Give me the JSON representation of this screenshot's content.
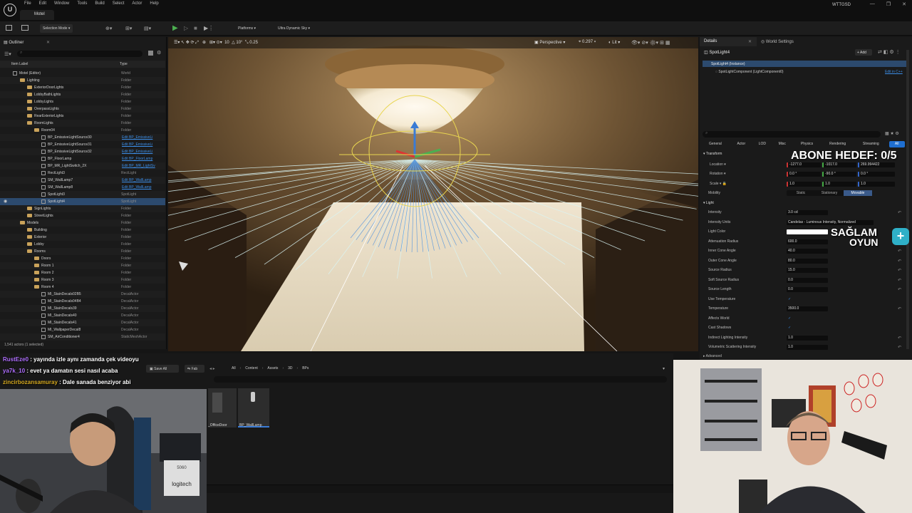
{
  "window": {
    "app_tab": "Motel",
    "user": "WTTGSD",
    "menu": [
      "File",
      "Edit",
      "Window",
      "Tools",
      "Build",
      "Select",
      "Actor",
      "Help"
    ],
    "controls": [
      "—",
      "❐",
      "✕"
    ]
  },
  "toolbar": {
    "selection_mode": "Selection Mode",
    "platforms": "Platforms",
    "sky": "Ultra Dynamic Sky"
  },
  "outliner": {
    "tab": "Outliner",
    "col_label": "Item Label",
    "col_type": "Type",
    "status": "1,541 actors (1 selected)",
    "rows": [
      {
        "label": "Motel (Editor)",
        "type": "World",
        "indent": 0,
        "kind": "world"
      },
      {
        "label": "Lighting",
        "type": "Folder",
        "indent": 1,
        "kind": "folder"
      },
      {
        "label": "ExteriorDoorLights",
        "type": "Folder",
        "indent": 2,
        "kind": "folder"
      },
      {
        "label": "LobbyBathLights",
        "type": "Folder",
        "indent": 2,
        "kind": "folder"
      },
      {
        "label": "LobbyLights",
        "type": "Folder",
        "indent": 2,
        "kind": "folder"
      },
      {
        "label": "OverpassLights",
        "type": "Folder",
        "indent": 2,
        "kind": "folder"
      },
      {
        "label": "RearExteriorLights",
        "type": "Folder",
        "indent": 2,
        "kind": "folder"
      },
      {
        "label": "RoomLights",
        "type": "Folder",
        "indent": 2,
        "kind": "folder"
      },
      {
        "label": "Room04",
        "type": "Folder",
        "indent": 3,
        "kind": "folder"
      },
      {
        "label": "BP_EmissiveLightSource30",
        "type": "Edit BP_EmissiveLi",
        "indent": 4,
        "kind": "bp"
      },
      {
        "label": "BP_EmissiveLightSource31",
        "type": "Edit BP_EmissiveLi",
        "indent": 4,
        "kind": "bp"
      },
      {
        "label": "BP_EmissiveLightSource32",
        "type": "Edit BP_EmissiveLi",
        "indent": 4,
        "kind": "bp"
      },
      {
        "label": "BP_FloorLamp",
        "type": "Edit BP_FloorLamp",
        "indent": 4,
        "kind": "bp"
      },
      {
        "label": "BP_MR_LightSwitch_2X",
        "type": "Edit BP_MR_LightSv",
        "indent": 4,
        "kind": "bp"
      },
      {
        "label": "RectLight3",
        "type": "RectLight",
        "indent": 4,
        "kind": "actor"
      },
      {
        "label": "SM_WallLamp7",
        "type": "Edit BP_WallLamp",
        "indent": 4,
        "kind": "bp"
      },
      {
        "label": "SM_WallLamp8",
        "type": "Edit BP_WallLamp",
        "indent": 4,
        "kind": "bp"
      },
      {
        "label": "SpotLight3",
        "type": "SpotLight",
        "indent": 4,
        "kind": "actor"
      },
      {
        "label": "SpotLight4",
        "type": "SpotLight",
        "indent": 4,
        "kind": "actor",
        "selected": true
      },
      {
        "label": "SignLights",
        "type": "Folder",
        "indent": 2,
        "kind": "folder"
      },
      {
        "label": "StreetLights",
        "type": "Folder",
        "indent": 2,
        "kind": "folder"
      },
      {
        "label": "Models",
        "type": "Folder",
        "indent": 1,
        "kind": "folder"
      },
      {
        "label": "Building",
        "type": "Folder",
        "indent": 2,
        "kind": "folder"
      },
      {
        "label": "Exterior",
        "type": "Folder",
        "indent": 2,
        "kind": "folder"
      },
      {
        "label": "Lobby",
        "type": "Folder",
        "indent": 2,
        "kind": "folder"
      },
      {
        "label": "Rooms",
        "type": "Folder",
        "indent": 2,
        "kind": "folder"
      },
      {
        "label": "Doors",
        "type": "Folder",
        "indent": 3,
        "kind": "folder"
      },
      {
        "label": "Room 1",
        "type": "Folder",
        "indent": 3,
        "kind": "folder"
      },
      {
        "label": "Room 2",
        "type": "Folder",
        "indent": 3,
        "kind": "folder"
      },
      {
        "label": "Room 3",
        "type": "Folder",
        "indent": 3,
        "kind": "folder"
      },
      {
        "label": "Room 4",
        "type": "Folder",
        "indent": 3,
        "kind": "folder"
      },
      {
        "label": "MI_StainDecals02B5",
        "type": "DecalActor",
        "indent": 4,
        "kind": "actor"
      },
      {
        "label": "MI_StainDecals04B4",
        "type": "DecalActor",
        "indent": 4,
        "kind": "actor"
      },
      {
        "label": "MI_StainDecals39",
        "type": "DecalActor",
        "indent": 4,
        "kind": "actor"
      },
      {
        "label": "MI_StainDecals40",
        "type": "DecalActor",
        "indent": 4,
        "kind": "actor"
      },
      {
        "label": "MI_StainDecals41",
        "type": "DecalActor",
        "indent": 4,
        "kind": "actor"
      },
      {
        "label": "MI_WallpaperDecal8",
        "type": "DecalActor",
        "indent": 4,
        "kind": "actor"
      },
      {
        "label": "SM_AirConditioner4",
        "type": "StaticMeshActor",
        "indent": 4,
        "kind": "actor"
      }
    ]
  },
  "viewport": {
    "perspective": "Perspective",
    "lit": "Lit",
    "grid": "10",
    "angle": "10°",
    "scale": "0.25",
    "fov": "0.297"
  },
  "details": {
    "tab": "Details",
    "tab2": "World Settings",
    "actor_name": "SpotLight4",
    "add": "+ Add",
    "instance": "SpotLight4 (Instance)",
    "component": "SpotLightComponent (LightComponent0)",
    "edit_cpp": "Edit in C++",
    "filters": [
      "General",
      "Actor",
      "LOD",
      "Misc",
      "Physics",
      "Rendering",
      "Streaming",
      "All"
    ],
    "transform": "Transform",
    "location_lbl": "Location",
    "rotation_lbl": "Rotation",
    "scale_lbl": "Scale",
    "mobility_lbl": "Mobility",
    "location": [
      "-1277.0",
      "-1017.0",
      "269.994422"
    ],
    "rotation": [
      "0.0 °",
      "-90.0 °",
      "0.0 °"
    ],
    "scale": [
      "1.0",
      "1.0",
      "1.0"
    ],
    "mobility": [
      "Static",
      "Stationary",
      "Movable"
    ],
    "light": "Light",
    "props": [
      {
        "label": "Intensity",
        "value": "3.0 cd"
      },
      {
        "label": "Intensity Units",
        "value": "Candelas - Luminous Intensity, Normalized"
      },
      {
        "label": "Light Color",
        "value": ""
      },
      {
        "label": "Attenuation Radius",
        "value": "600.0"
      },
      {
        "label": "Inner Cone Angle",
        "value": "40.0"
      },
      {
        "label": "Outer Cone Angle",
        "value": "80.0"
      },
      {
        "label": "Source Radius",
        "value": "15.0"
      },
      {
        "label": "Soft Source Radius",
        "value": "0.0"
      },
      {
        "label": "Source Length",
        "value": "0.0"
      },
      {
        "label": "Use Temperature",
        "value": "✓"
      },
      {
        "label": "Temperature",
        "value": "3500.0"
      },
      {
        "label": "Affects World",
        "value": "✓"
      },
      {
        "label": "Cast Shadows",
        "value": "✓"
      },
      {
        "label": "Indirect Lighting Intensity",
        "value": "1.0"
      },
      {
        "label": "Volumetric Scattering Intensity",
        "value": "1.0"
      }
    ],
    "advanced": "Advanced"
  },
  "content": {
    "save_all": "Save All",
    "fab": "Fab",
    "breadcrumb": [
      "All",
      "Content",
      "Assets",
      "3D",
      "BPs"
    ],
    "assets": [
      "_OfficeDoor",
      "BP_WallLamp"
    ]
  },
  "chat": [
    {
      "user": "RustEze0",
      "msg": "yayında izle aynı zamanda çek videoyu",
      "color": "#b070ff"
    },
    {
      "user": "ya7k_10",
      "msg": "evet ya damatın sesi nasıl acaba",
      "color": "#b070ff"
    },
    {
      "user": "zincirbozansamuray",
      "msg": "Dale sanada benziyor abi",
      "color": "#d4a820"
    }
  ],
  "overlay": {
    "goal": "ABONE HEDEF: 0/5",
    "logo_top": "SAĞLAM",
    "logo_bottom": "OYUN"
  },
  "webcam": {
    "brand": "logitech",
    "gpu": "5060"
  },
  "colors": {
    "accent_blue": "#1f6fd1",
    "selected_row": "#2c4a6e",
    "movable": "#3a5a8a"
  }
}
